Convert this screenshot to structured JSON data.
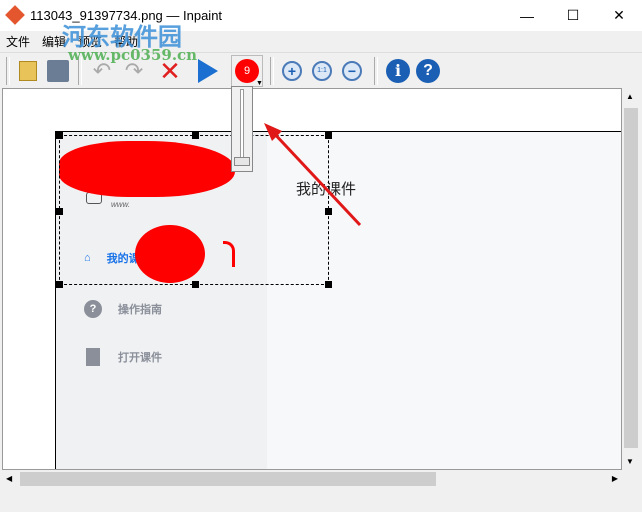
{
  "window": {
    "title": "113043_91397734.png — Inpaint",
    "minimize": "—",
    "maximize": "☐",
    "close": "✕"
  },
  "menu": [
    "文件",
    "编辑",
    "预览",
    "帮助"
  ],
  "toolbar": {
    "brush_size": "9",
    "zoom_reset": "1:1",
    "info": "i",
    "help": "?"
  },
  "watermark": {
    "name": "河东软件园",
    "url": "www.pc0359.cn"
  },
  "image": {
    "heading": "我的课件",
    "nav": [
      {
        "label": "我的课件",
        "icon": "home-icon"
      },
      {
        "label": "操作指南",
        "icon": "question-icon"
      },
      {
        "label": "打开课件",
        "icon": "document-icon"
      }
    ],
    "small_text": "www."
  },
  "colors": {
    "mask": "#ff0000",
    "accent": "#1a73e8"
  }
}
